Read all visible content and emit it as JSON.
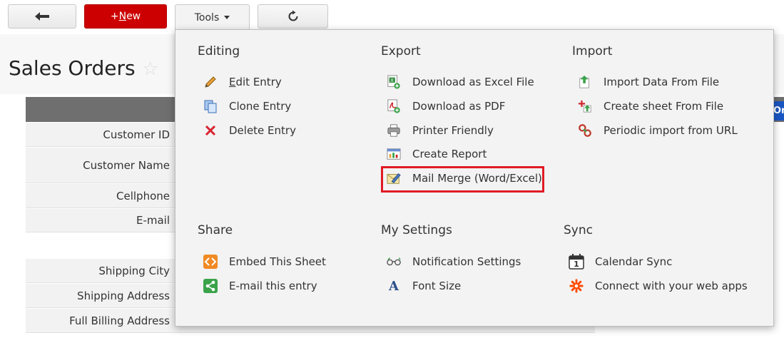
{
  "toolbar": {
    "new_plus": "+",
    "new_underlined": "N",
    "new_rest": "ew",
    "tools_label": "Tools"
  },
  "page": {
    "title": "Sales Orders",
    "header_tab_text": "On"
  },
  "form": {
    "fields": [
      "Customer ID",
      "Customer Name",
      "Cellphone",
      "E-mail",
      "Shipping City",
      "Shipping Address",
      "Full Billing Address"
    ]
  },
  "menu": {
    "editing": {
      "title": "Editing",
      "edit_underlined": "E",
      "edit_rest": "dit Entry",
      "clone": "Clone Entry",
      "delete": "Delete Entry"
    },
    "export": {
      "title": "Export",
      "excel": "Download as Excel File",
      "pdf": "Download as PDF",
      "printer": "Printer Friendly",
      "report": "Create Report",
      "mail_merge": "Mail Merge (Word/Excel)"
    },
    "import": {
      "title": "Import",
      "from_file": "Import Data From File",
      "create_sheet": "Create sheet From File",
      "periodic": "Periodic import from URL"
    },
    "share": {
      "title": "Share",
      "embed": "Embed This Sheet",
      "email": "E-mail this entry"
    },
    "my_settings": {
      "title": "My Settings",
      "notifications": "Notification Settings",
      "font_size": "Font Size",
      "font_icon_letter": "A"
    },
    "sync": {
      "title": "Sync",
      "calendar": "Calendar Sync",
      "calendar_icon_number": "1",
      "connect": "Connect with your web apps"
    }
  },
  "colors": {
    "new_button": "#cc0000",
    "highlight": "#e01b24",
    "header_bar": "#6f6f6f",
    "blue_tab": "#1a56c2"
  }
}
